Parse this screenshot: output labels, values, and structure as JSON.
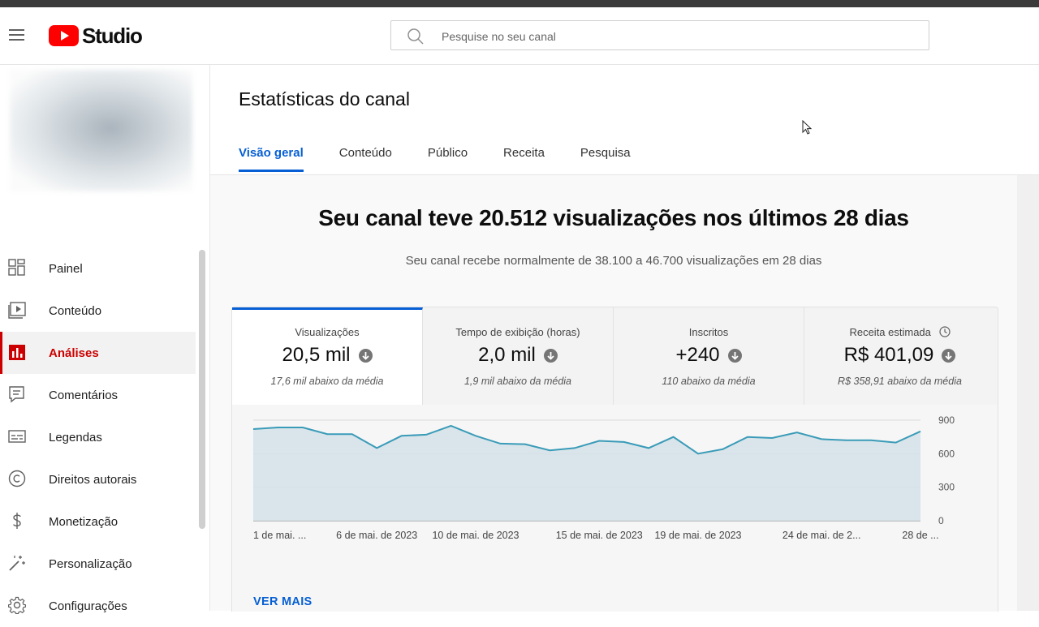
{
  "header": {
    "logo_text": "Studio",
    "search_placeholder": "Pesquise no seu canal"
  },
  "sidebar": {
    "items": [
      {
        "label": "Painel",
        "icon": "dashboard-icon"
      },
      {
        "label": "Conteúdo",
        "icon": "content-icon"
      },
      {
        "label": "Análises",
        "icon": "analytics-icon",
        "active": true
      },
      {
        "label": "Comentários",
        "icon": "comments-icon"
      },
      {
        "label": "Legendas",
        "icon": "subtitles-icon"
      },
      {
        "label": "Direitos autorais",
        "icon": "copyright-icon"
      },
      {
        "label": "Monetização",
        "icon": "monetization-icon"
      },
      {
        "label": "Personalização",
        "icon": "customization-icon"
      },
      {
        "label": "Configurações",
        "icon": "settings-icon"
      }
    ]
  },
  "main": {
    "title": "Estatísticas do canal",
    "tabs": [
      "Visão geral",
      "Conteúdo",
      "Público",
      "Receita",
      "Pesquisa"
    ],
    "active_tab": "Visão geral",
    "headline": "Seu canal teve 20.512 visualizações nos últimos 28 dias",
    "subline": "Seu canal recebe normalmente de 38.100 a 46.700 visualizações em 28 dias",
    "metrics": [
      {
        "label": "Visualizações",
        "value": "20,5 mil",
        "sub": "17,6 mil abaixo da média"
      },
      {
        "label": "Tempo de exibição (horas)",
        "value": "2,0 mil",
        "sub": "1,9 mil abaixo da média"
      },
      {
        "label": "Inscritos",
        "value": "+240",
        "sub": "110 abaixo da média"
      },
      {
        "label": "Receita estimada",
        "value": "R$ 401,09",
        "sub": "R$ 358,91 abaixo da média"
      }
    ],
    "see_more": "VER MAIS"
  },
  "colors": {
    "brand_red": "#ff0000",
    "active_red": "#cc0000",
    "accent_blue": "#065fd4",
    "chart_line": "#3a9bb8",
    "chart_fill": "#d3e2e8"
  },
  "chart_data": {
    "type": "area",
    "x": [
      "1 de mai.",
      "2 de mai.",
      "3 de mai.",
      "4 de mai.",
      "5 de mai.",
      "6 de mai.",
      "7 de mai.",
      "8 de mai.",
      "9 de mai.",
      "10 de mai.",
      "11 de mai.",
      "12 de mai.",
      "13 de mai.",
      "14 de mai.",
      "15 de mai.",
      "16 de mai.",
      "17 de mai.",
      "18 de mai.",
      "19 de mai.",
      "20 de mai.",
      "21 de mai.",
      "22 de mai.",
      "23 de mai.",
      "24 de mai.",
      "25 de mai.",
      "26 de mai.",
      "27 de mai.",
      "28 de mai."
    ],
    "series": [
      {
        "values": [
          820,
          835,
          835,
          775,
          775,
          650,
          760,
          770,
          850,
          760,
          690,
          685,
          630,
          650,
          715,
          705,
          650,
          750,
          600,
          640,
          750,
          740,
          790,
          730,
          720,
          720,
          700,
          800
        ]
      }
    ],
    "x_tick_labels": [
      {
        "index": 0,
        "label": "1 de mai. ..."
      },
      {
        "index": 5,
        "label": "6 de mai. de 2023"
      },
      {
        "index": 9,
        "label": "10 de mai. de 2023"
      },
      {
        "index": 14,
        "label": "15 de mai. de 2023"
      },
      {
        "index": 18,
        "label": "19 de mai. de 2023"
      },
      {
        "index": 23,
        "label": "24 de mai. de 2..."
      },
      {
        "index": 27,
        "label": "28 de ..."
      }
    ],
    "y_ticks": [
      0,
      300,
      600,
      900
    ],
    "ylim": [
      0,
      900
    ],
    "grid": true
  }
}
